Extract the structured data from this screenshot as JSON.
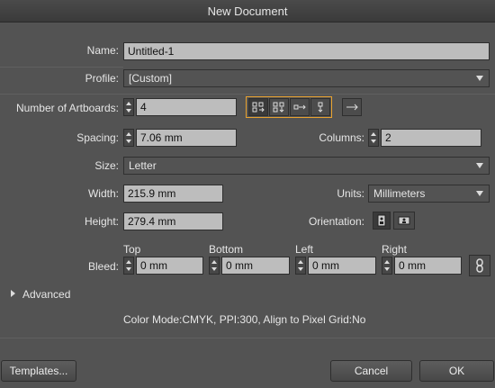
{
  "window": {
    "title": "New Document"
  },
  "name": {
    "label": "Name:",
    "value": "Untitled-1"
  },
  "profile": {
    "label": "Profile:",
    "value": "[Custom]"
  },
  "artboards": {
    "label": "Number of Artboards:",
    "value": "4",
    "layout_icons": [
      "grid-by-row-icon",
      "grid-by-column-icon",
      "arrange-by-row-icon",
      "arrange-by-column-icon"
    ],
    "direction_icon": "right-to-left-layout-icon"
  },
  "spacing": {
    "label": "Spacing:",
    "value": "7.06 mm"
  },
  "columns": {
    "label": "Columns:",
    "value": "2"
  },
  "size": {
    "label": "Size:",
    "value": "Letter"
  },
  "width": {
    "label": "Width:",
    "value": "215.9 mm"
  },
  "units": {
    "label": "Units:",
    "value": "Millimeters"
  },
  "height": {
    "label": "Height:",
    "value": "279.4 mm"
  },
  "orientation": {
    "label": "Orientation:",
    "options": [
      "portrait-icon",
      "landscape-icon"
    ],
    "selected": "portrait-icon"
  },
  "bleed": {
    "label": "Bleed:",
    "top": {
      "label": "Top",
      "value": "0 mm"
    },
    "bottom": {
      "label": "Bottom",
      "value": "0 mm"
    },
    "left": {
      "label": "Left",
      "value": "0 mm"
    },
    "right": {
      "label": "Right",
      "value": "0 mm"
    },
    "link_icon": "link-icon"
  },
  "advanced": {
    "label": "Advanced"
  },
  "summary": "Color Mode:CMYK, PPI:300, Align to Pixel Grid:No",
  "buttons": {
    "templates": "Templates...",
    "cancel": "Cancel",
    "ok": "OK"
  },
  "colors": {
    "background": "#535353",
    "field": "#bdbdbd",
    "selection_outline": "#e8a22f"
  }
}
